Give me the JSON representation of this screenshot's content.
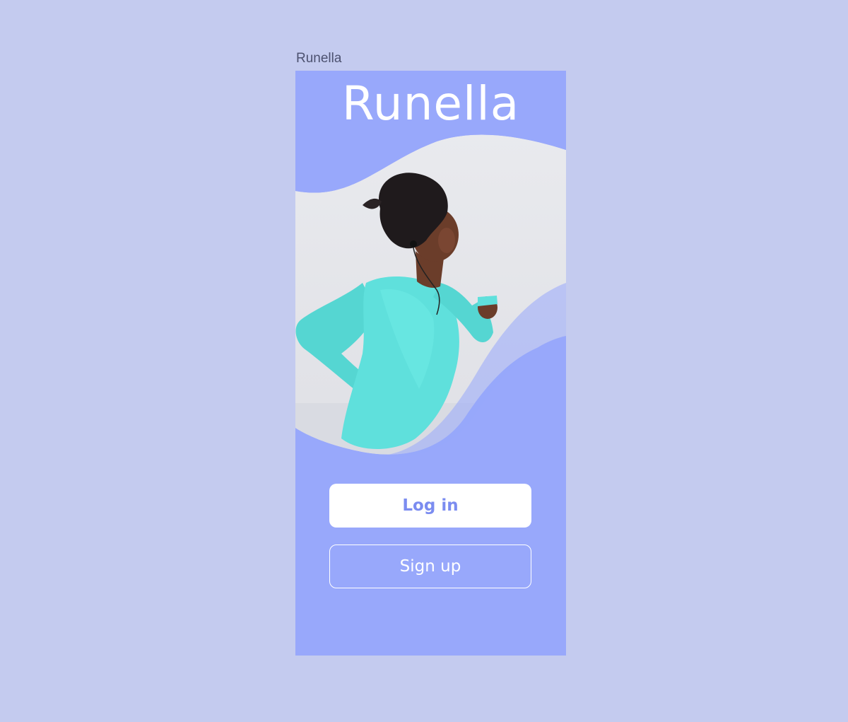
{
  "frame": {
    "label": "Runella"
  },
  "app": {
    "logo_text": "Runella"
  },
  "actions": {
    "login_label": "Log in",
    "signup_label": "Sign up"
  },
  "colors": {
    "canvas_bg": "#c4cbef",
    "screen_bg": "#98a8fb",
    "photo_bg": "#e6e7eb",
    "top_wash": "#eff0f3",
    "shirt": "#5fe0dc",
    "skin": "#6b3d2a",
    "hair": "#1f1a1c",
    "login_text": "#7b8cf0",
    "white": "#ffffff"
  },
  "hero": {
    "image_description_icon": "runner-photo"
  }
}
